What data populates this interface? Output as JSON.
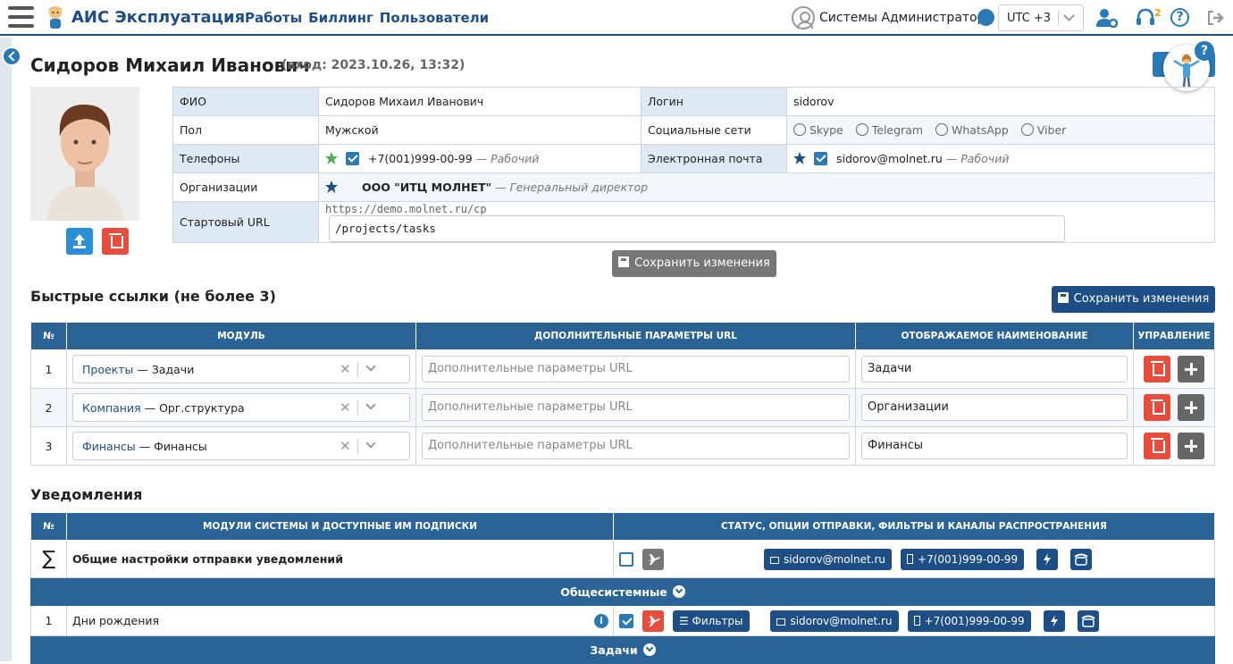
{
  "app": {
    "title": "АИС Эксплуатация"
  },
  "nav": {
    "items": [
      "Работы",
      "Биллинг",
      "Пользователи"
    ]
  },
  "topbar": {
    "user_name": "Системы Администратор",
    "timezone": "UTC +3",
    "notifications_count": "2",
    "help": "?"
  },
  "header": {
    "name": "Сидоров Михаил Иванович",
    "login_info": "(вход: 2023.10.26, 13:32)"
  },
  "profile": {
    "fio_label": "ФИО",
    "fio": "Сидоров Михаил Иванович",
    "login_label": "Логин",
    "login": "sidorov",
    "gender_label": "Пол",
    "gender": "Мужской",
    "social_label": "Социальные сети",
    "socials": [
      "Skype",
      "Telegram",
      "WhatsApp",
      "Viber"
    ],
    "phones_label": "Телефоны",
    "phone": "+7(001)999-00-99",
    "phone_type": "— Рабочий",
    "email_label": "Электронная почта",
    "email": "sidorov@molnet.ru",
    "email_type": "— Рабочий",
    "org_label": "Организации",
    "org": "ООО \"ИТЦ МОЛНЕТ\"",
    "org_position": "— Генеральный директор",
    "start_url_label": "Стартовый URL",
    "url_prefix": "https://demo.molnet.ru/cp",
    "start_url": "/projects/tasks",
    "save_label": "Сохранить изменения"
  },
  "quick_links": {
    "title": "Быстрые ссылки (не более 3)",
    "save_label": "Сохранить изменения",
    "headers": {
      "num": "№",
      "module": "Модуль",
      "params": "Дополнительные параметры URL",
      "display": "Отображаемое наименование",
      "actions": "Управление"
    },
    "rows": [
      {
        "num": "1",
        "module": "Проекты",
        "sub": "— Задачи",
        "params_placeholder": "Дополнительные параметры URL",
        "display": "Задачи"
      },
      {
        "num": "2",
        "module": "Компания",
        "sub": "— Орг.структура",
        "params_placeholder": "Дополнительные параметры URL",
        "display": "Организации"
      },
      {
        "num": "3",
        "module": "Финансы",
        "sub": "— Финансы",
        "params_placeholder": "Дополнительные параметры URL",
        "display": "Финансы"
      }
    ]
  },
  "notifications": {
    "title": "Уведомления",
    "headers": {
      "num": "№",
      "modules": "МОДУЛИ СИСТЕМЫ И ДОСТУПНЫЕ ИМ ПОДПИСКИ",
      "status": "СТАТУС, ОПЦИИ ОТПРАВКИ, ФИЛЬТРЫ И КАНАЛЫ РАСПРОСТРАНЕНИЯ"
    },
    "general_symbol": "∑",
    "general_label": "Общие настройки отправки уведомлений",
    "group1": "Общесистемные",
    "row1_num": "1",
    "row1_label": "Дни рождения",
    "filters_label": "Фильтры",
    "email_chip": "sidorov@molnet.ru",
    "phone_chip": "+7(001)999-00-99",
    "group2": "Задачи"
  },
  "colors": {
    "brand": "#1d4e86",
    "table_header": "#2a6496",
    "danger": "#e74c3c",
    "success_star": "#4caf50"
  }
}
